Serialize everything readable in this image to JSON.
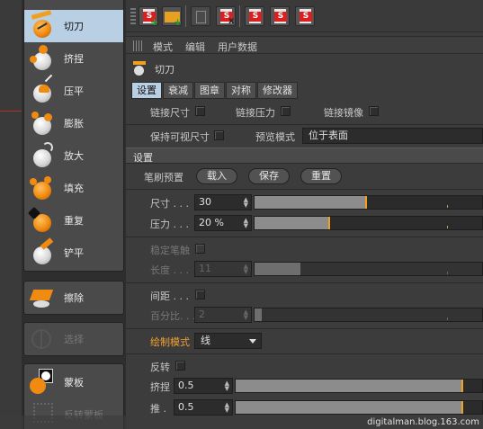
{
  "tools": [
    {
      "label": "切刀",
      "icon": "knife-ball-icon",
      "selected": true
    },
    {
      "label": "挤捏",
      "icon": "pinch-ball-icon"
    },
    {
      "label": "压平",
      "icon": "flatten-ball-icon"
    },
    {
      "label": "膨胀",
      "icon": "inflate-ball-icon"
    },
    {
      "label": "放大",
      "icon": "magnify-ball-icon"
    },
    {
      "label": "填充",
      "icon": "fill-ball-icon"
    },
    {
      "label": "重复",
      "icon": "repeat-ball-icon"
    },
    {
      "label": "铲平",
      "icon": "scrape-ball-icon"
    },
    {
      "label": "擦除",
      "icon": "erase-icon"
    },
    {
      "label": "选择",
      "icon": "select-icon",
      "disabled": true
    },
    {
      "label": "蒙板",
      "icon": "mask-icon"
    },
    {
      "label": "反转蒙板",
      "icon": "invert-mask-icon",
      "disabled": true
    }
  ],
  "toolbar": {
    "buttons": [
      "s-new-icon",
      "s-open-folder-icon",
      "trash-icon",
      "s-delete-icon",
      "s-export-1-icon",
      "s-export-2-icon",
      "s-export-3-icon"
    ],
    "button_s_label": "S"
  },
  "menubar": {
    "items": [
      "模式",
      "编辑",
      "用户数据"
    ]
  },
  "object": {
    "title": "切刀"
  },
  "tabs": [
    "设置",
    "衰减",
    "图章",
    "对称",
    "修改器"
  ],
  "link_row": {
    "link_size": "链接尺寸",
    "link_pressure": "链接压力",
    "link_mirror": "链接镜像"
  },
  "visible_row": {
    "keep_visible_size": "保持可视尺寸",
    "preview_mode_label": "预览模式",
    "preview_mode_value": "位于表面"
  },
  "settings_section": {
    "title": "设置"
  },
  "brush_preset": {
    "label": "笔刷预置",
    "load": "载入",
    "save": "保存",
    "reset": "重置"
  },
  "size": {
    "label": "尺寸 . . .",
    "value": "30",
    "fraction": 0.49
  },
  "pressure": {
    "label": "压力 . . .",
    "value": "20 %",
    "fraction": 0.33
  },
  "stabilize": {
    "label": "稳定笔触",
    "length_label": "长度 . . .",
    "length_value": "11",
    "length_fraction": 0.2
  },
  "spacing": {
    "label": "间距 . . .",
    "percent_label": "百分比. . .",
    "percent_value": "2",
    "percent_fraction": 0.03
  },
  "draw_mode": {
    "label": "绘制模式",
    "value": "线"
  },
  "invert": {
    "label": "反转"
  },
  "pinch": {
    "label": "挤捏",
    "value": "0.5",
    "fraction": 0.92
  },
  "push": {
    "label": "推 .",
    "value": "0.5",
    "fraction": 0.92
  },
  "colors": {
    "accent": "#f0a020",
    "selected_tab": "#b9cfe3"
  },
  "watermark": "digitalman.blog.163.com"
}
